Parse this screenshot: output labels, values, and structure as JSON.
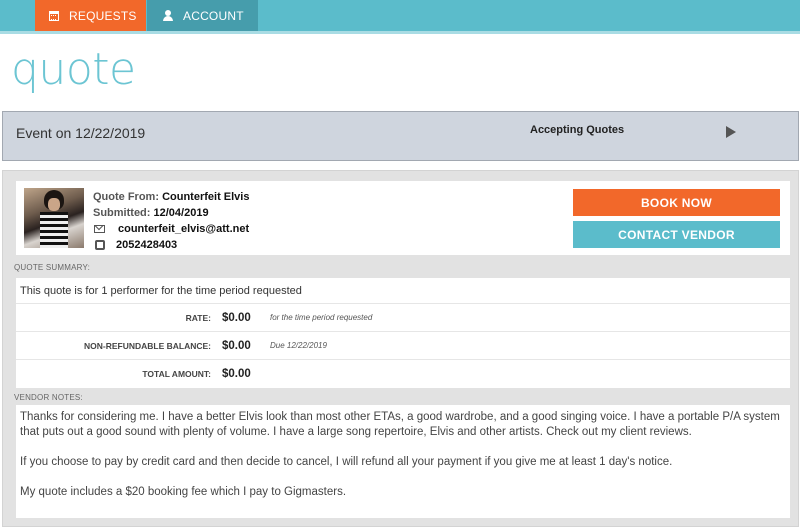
{
  "nav": {
    "tabs": [
      {
        "label": "REQUESTS",
        "icon": "calendar-icon",
        "active": true
      },
      {
        "label": "ACCOUNT",
        "icon": "user-icon",
        "active": false
      }
    ]
  },
  "page": {
    "title": "quote"
  },
  "event": {
    "title": "Event on 12/22/2019",
    "status": "Accepting Quotes",
    "expand_icon": "play-arrow-icon"
  },
  "quote": {
    "from_label": "Quote From:",
    "from_value": "Counterfeit Elvis",
    "submitted_label": "Submitted:",
    "submitted_value": "12/04/2019",
    "email": "counterfeit_elvis@att.net",
    "phone": "2052428403",
    "book_label": "BOOK NOW",
    "contact_label": "CONTACT VENDOR"
  },
  "summary": {
    "section_label": "QUOTE SUMMARY:",
    "description": "This quote is for 1 performer for the time period requested",
    "rows": [
      {
        "label": "RATE:",
        "amount": "$0.00",
        "note": "for the time period requested"
      },
      {
        "label": "NON-REFUNDABLE BALANCE:",
        "amount": "$0.00",
        "note": "Due 12/22/2019"
      },
      {
        "label": "TOTAL AMOUNT:",
        "amount": "$0.00",
        "note": ""
      }
    ]
  },
  "notes": {
    "section_label": "VENDOR NOTES:",
    "paragraphs": [
      "Thanks for considering me. I have a better Elvis look than most other ETAs, a good wardrobe, and a good singing voice. I have a portable P/A system that puts out a good sound with plenty of volume. I have a large song repertoire, Elvis and other artists. Check out my client reviews.",
      "If you choose to pay by credit card and then decide to cancel, I will refund all your payment if you give me at least 1 day's notice.",
      "My quote includes a $20 booking fee which I pay to Gigmasters."
    ]
  },
  "colors": {
    "accent_orange": "#f2682a",
    "accent_teal": "#5bbccb",
    "title_teal": "#6cc5d3"
  }
}
